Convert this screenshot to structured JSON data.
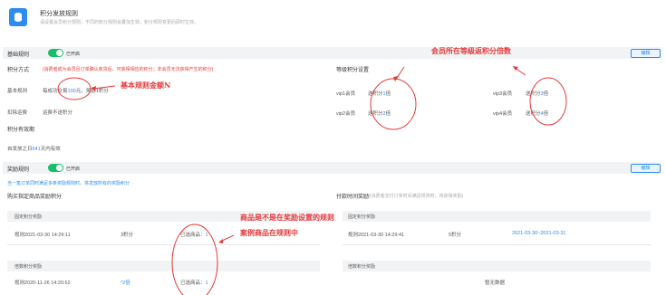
{
  "header": {
    "title": "积分发放规则",
    "subtitle": "请设置会员积分规则，不同的积分规则会叠加生效，积分规则变更后即时生效。"
  },
  "basic": {
    "bar_label": "基础规则",
    "toggle_text": "已开启",
    "edit_label": "编辑",
    "method_label": "积分方式",
    "method_note": "(消费者成为会员且订单确认收货后，可获得相应的积分；非会员无法获得产生的积分)",
    "basic_rule_label": "基本规则",
    "basic_rule_prefix": "每成功交易",
    "basic_rule_amount": "100",
    "basic_rule_suffix": "元，奖励1积分",
    "refund_label": "扣除运费",
    "refund_value": "运费不送积分",
    "validity_label": "积分有效期",
    "validity_prefix": "自发放之日",
    "validity_days": "641",
    "validity_suffix": "天内有效",
    "level_title": "等级积分设置",
    "levels": [
      {
        "name": "vip1会员",
        "multiplier_prefix": "送积分",
        "multiplier": "1",
        "unit": "倍"
      },
      {
        "name": "vip3会员",
        "multiplier_prefix": "送积分",
        "multiplier": "3",
        "unit": "倍"
      },
      {
        "name": "vip2会员",
        "multiplier_prefix": "送积分",
        "multiplier": "2",
        "unit": "倍"
      },
      {
        "name": "vip4会员",
        "multiplier_prefix": "送积分",
        "multiplier": "4",
        "unit": "倍"
      }
    ]
  },
  "reward": {
    "bar_label": "奖励规则",
    "toggle_text": "已开启",
    "edit_label": "编辑",
    "note": "当一笔订单同时满足多条奖励规则时，将发放所有的奖励积分",
    "left_title": "购买指定商品奖励积分",
    "right_title": "付款时间奖励",
    "right_note": "(当消费者支付订单时间满足规则时，将获得奖励)",
    "fixed_title": "固定积分奖励",
    "fixed_rule": "规则2021-03-30 14:29:11",
    "fixed_points": "3积分",
    "fixed_goods_prefix": "已选商品：",
    "fixed_goods_count": "1",
    "fixed_time_title": "固定积分奖励",
    "fixed_time_rule": "规则2021-03-30 14:29:41",
    "fixed_time_points": "5积分",
    "fixed_time_range": "2021-03-30~2021-03-31",
    "multi_title": "倍数积分奖励",
    "multi_rule": "规则2020-11-26 14:20:52",
    "multi_value": "*2倍",
    "multi_goods_prefix": "已选商品：",
    "multi_goods_count": "1",
    "multi_time_title": "倍数积分奖励",
    "multi_time_empty": "暂无数据"
  },
  "annotations": {
    "level_note": "会员所在等级返积分倍数",
    "basic_note": "基本规则金额N",
    "goods_rule_note": "商品是不是在奖励设置的规则",
    "goods_in_rule_note": "案例商品在规则中"
  },
  "colors": {
    "accent": "#2d8cf0",
    "toggle_on": "#19be6b",
    "annotation": "#e4393c"
  }
}
